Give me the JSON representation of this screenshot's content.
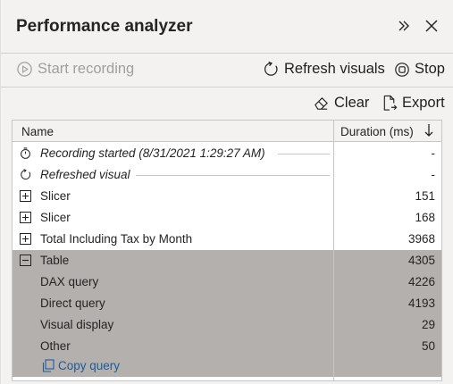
{
  "pane": {
    "title": "Performance analyzer",
    "expand_icon": "double-chevron-right-icon",
    "close_icon": "close-icon"
  },
  "toolbar": {
    "start_recording": "Start recording",
    "refresh_visuals": "Refresh visuals",
    "stop": "Stop",
    "clear": "Clear",
    "export": "Export"
  },
  "grid": {
    "col_name": "Name",
    "col_duration": "Duration (ms)",
    "rows": [
      {
        "name": "Recording started (8/31/2021 1:29:27 AM)",
        "duration": "-"
      },
      {
        "name": "Refreshed visual",
        "duration": "-"
      },
      {
        "name": "Slicer",
        "duration": "151"
      },
      {
        "name": "Slicer",
        "duration": "168"
      },
      {
        "name": "Total Including Tax by Month",
        "duration": "3968"
      },
      {
        "name": "Table",
        "duration": "4305"
      },
      {
        "name": "DAX query",
        "duration": "4226"
      },
      {
        "name": "Direct query",
        "duration": "4193"
      },
      {
        "name": "Visual display",
        "duration": "29"
      },
      {
        "name": "Other",
        "duration": "50"
      }
    ],
    "copy_query": "Copy query"
  },
  "colors": {
    "selected_row": "#b3b0ad",
    "link": "#1f5b9a",
    "disabled_text": "#a19f9d"
  }
}
